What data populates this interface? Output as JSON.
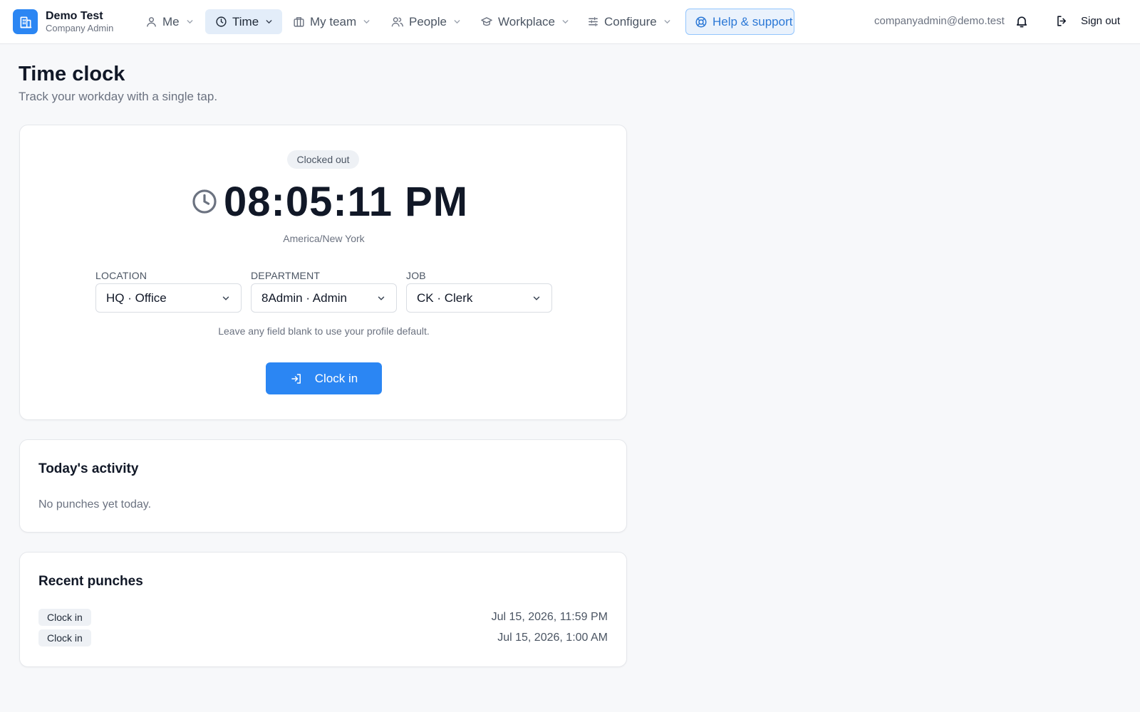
{
  "brand": {
    "name": "Demo Test",
    "role": "Company Admin"
  },
  "nav": {
    "items": [
      {
        "id": "me",
        "label": "Me",
        "icon": "user-icon"
      },
      {
        "id": "time",
        "label": "Time",
        "icon": "clock-icon",
        "active": true
      },
      {
        "id": "my-team",
        "label": "My team",
        "icon": "building-icon"
      },
      {
        "id": "people",
        "label": "People",
        "icon": "users-icon"
      },
      {
        "id": "workplace",
        "label": "Workplace",
        "icon": "graduation-cap-icon"
      },
      {
        "id": "configure",
        "label": "Configure",
        "icon": "sliders-icon"
      }
    ],
    "help": {
      "label": "Help & support",
      "icon": "lifebuoy-icon"
    },
    "user_email": "companyadmin@demo.test",
    "signout_label": "Sign out"
  },
  "page": {
    "title": "Time clock",
    "subtitle": "Track your workday with a single tap."
  },
  "clock": {
    "status": "Clocked out",
    "time": "08:05:11 PM",
    "timezone": "America/New York",
    "fields": [
      {
        "label": "LOCATION",
        "value": "HQ · Office"
      },
      {
        "label": "DEPARTMENT",
        "value": "8Admin · Admin"
      },
      {
        "label": "JOB",
        "value": "CK · Clerk"
      }
    ],
    "hint": "Leave any field blank to use your profile default.",
    "button_label": "Clock in"
  },
  "activity": {
    "title": "Today's activity",
    "empty": "No punches yet today."
  },
  "recent": {
    "title": "Recent punches",
    "rows": [
      {
        "type": "Clock in",
        "time": "Jul 15, 2026, 11:59 PM"
      },
      {
        "type": "Clock in",
        "time": "Jul 15, 2026, 1:00 AM"
      }
    ]
  },
  "colors": {
    "accent": "#2b86f3",
    "active_nav_bg": "#e3edf9",
    "help_border": "#93c5fd",
    "background": "#f7f8fa"
  }
}
